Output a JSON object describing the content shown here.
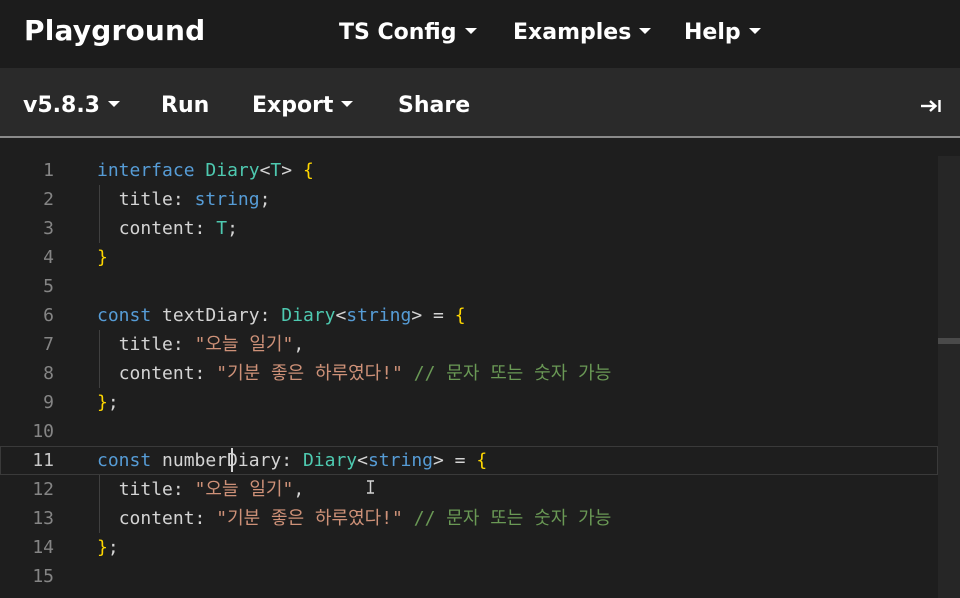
{
  "app": {
    "title": "Playground"
  },
  "topnav": {
    "items": [
      {
        "label": "TS Config"
      },
      {
        "label": "Examples"
      },
      {
        "label": "Help"
      }
    ]
  },
  "toolbar": {
    "version_label": "v5.8.3",
    "run_label": "Run",
    "export_label": "Export",
    "share_label": "Share",
    "sidebar_toggle_icon": "arrow-right-to-bar-icon"
  },
  "editor": {
    "current_line": 11,
    "lines": [
      {
        "n": "1"
      },
      {
        "n": "2"
      },
      {
        "n": "3"
      },
      {
        "n": "4"
      },
      {
        "n": "5"
      },
      {
        "n": "6"
      },
      {
        "n": "7"
      },
      {
        "n": "8"
      },
      {
        "n": "9"
      },
      {
        "n": "10"
      },
      {
        "n": "11"
      },
      {
        "n": "12"
      },
      {
        "n": "13"
      },
      {
        "n": "14"
      },
      {
        "n": "15"
      }
    ],
    "tokens": {
      "interface": "interface",
      "const": "const",
      "diary_type": "Diary",
      "generic_t": "T",
      "string_type": "string",
      "title_key": "title",
      "content_key": "content",
      "text_diary_name": "textDiary",
      "number_diary_name": "numberDiary",
      "title_value": "\"오늘 일기\"",
      "content_value": "\"기분 좋은 하루였다!\"",
      "comment": "// 문자 또는 숫자 가능"
    }
  },
  "colors": {
    "keyword": "#569cd6",
    "type": "#4ec9b0",
    "bracket": "#ffd700",
    "string": "#ce9178",
    "comment": "#6a9955",
    "text": "#d4d4d4"
  }
}
